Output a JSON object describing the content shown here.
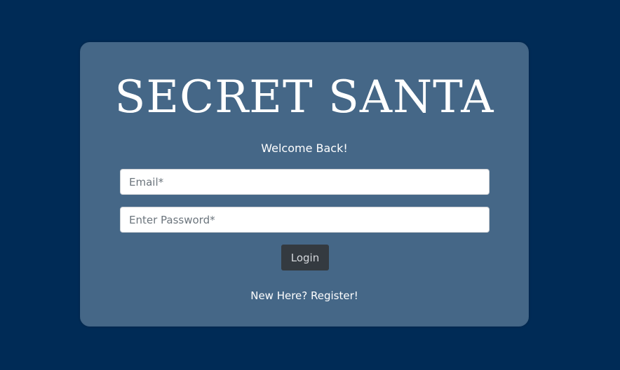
{
  "app": {
    "title": "SECRET SANTA"
  },
  "login": {
    "welcome_text": "Welcome Back!",
    "email_placeholder": "Email*",
    "password_placeholder": "Enter Password*",
    "login_button_label": "Login",
    "register_link_label": "New Here? Register!"
  },
  "colors": {
    "page_background": "#002b56",
    "card_background": "#456787",
    "button_background": "#343a40",
    "text_primary": "#ffffff"
  }
}
